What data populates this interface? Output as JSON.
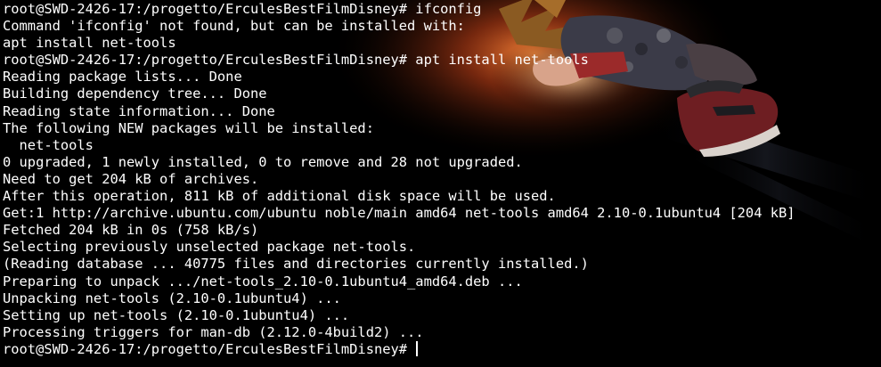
{
  "terminal": {
    "lines": [
      "root@SWD-2426-17:/progetto/ErculesBestFilmDisney# ifconfig",
      "Command 'ifconfig' not found, but can be installed with:",
      "apt install net-tools",
      "root@SWD-2426-17:/progetto/ErculesBestFilmDisney# apt install net-tools",
      "Reading package lists... Done",
      "Building dependency tree... Done",
      "Reading state information... Done",
      "The following NEW packages will be installed:",
      "  net-tools",
      "0 upgraded, 1 newly installed, 0 to remove and 28 not upgraded.",
      "Need to get 204 kB of archives.",
      "After this operation, 811 kB of additional disk space will be used.",
      "Get:1 http://archive.ubuntu.com/ubuntu noble/main amd64 net-tools amd64 2.10-0.1ubuntu4 [204 kB]",
      "Fetched 204 kB in 0s (758 kB/s)",
      "Selecting previously unselected package net-tools.",
      "(Reading database ... 40775 files and directories currently installed.)",
      "Preparing to unpack .../net-tools_2.10-0.1ubuntu4_amd64.deb ...",
      "Unpacking net-tools (2.10-0.1ubuntu4) ...",
      "Setting up net-tools (2.10-0.1ubuntu4) ...",
      "Processing triggers for man-db (2.12.0-4build2) ..."
    ],
    "prompt": "root@SWD-2426-17:/progetto/ErculesBestFilmDisney# "
  },
  "colors": {
    "background": "#000000",
    "foreground": "#ffffff"
  }
}
